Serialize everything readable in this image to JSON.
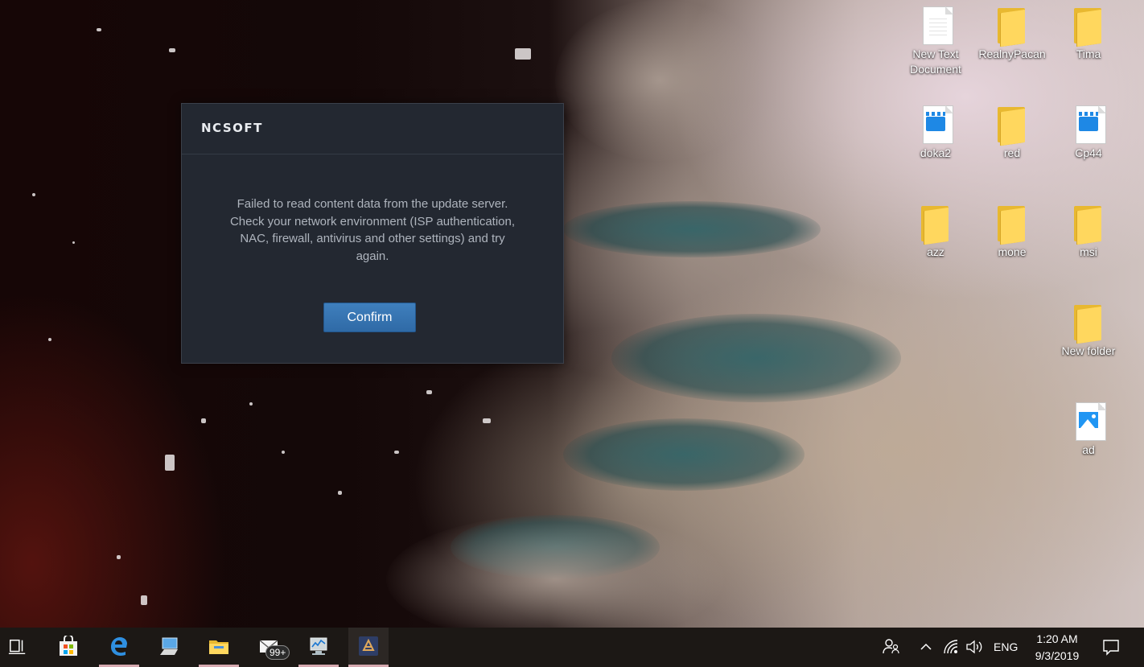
{
  "desktop": {
    "icons": [
      {
        "label": "New Text Document",
        "kind": "text-file"
      },
      {
        "label": "RealnyPacan",
        "kind": "folder"
      },
      {
        "label": "Tima",
        "kind": "folder"
      },
      {
        "label": "doka2",
        "kind": "video-file"
      },
      {
        "label": "red",
        "kind": "folder"
      },
      {
        "label": "Cp44",
        "kind": "video-file"
      },
      {
        "label": "azz",
        "kind": "folder"
      },
      {
        "label": "mone",
        "kind": "folder"
      },
      {
        "label": "msi",
        "kind": "folder"
      },
      {
        "label": "New folder",
        "kind": "folder"
      },
      {
        "label": "ad",
        "kind": "image-file"
      }
    ]
  },
  "dialog": {
    "brand": "NCSOFT",
    "message": "Failed to read content data from the update server.\nCheck your network environment (ISP authentication,\nNAC, firewall, antivirus and other settings) and try\nagain.",
    "confirm_label": "Confirm"
  },
  "taskbar": {
    "apps": [
      {
        "name": "microsoft-store-icon",
        "running": false
      },
      {
        "name": "edge-icon",
        "running": true
      },
      {
        "name": "this-pc-icon",
        "running": false
      },
      {
        "name": "file-explorer-icon",
        "running": true
      },
      {
        "name": "mail-icon",
        "running": false
      },
      {
        "name": "system-monitor-icon",
        "running": true
      },
      {
        "name": "launcher-app-icon",
        "running": true
      }
    ],
    "mail_badge": "99+",
    "language": "ENG",
    "time": "1:20 AM",
    "date": "9/3/2019"
  },
  "colors": {
    "dialog_bg": "#232831",
    "button": "#3572b0",
    "taskbar": "#1c1815",
    "folder": "#ffd75e"
  }
}
